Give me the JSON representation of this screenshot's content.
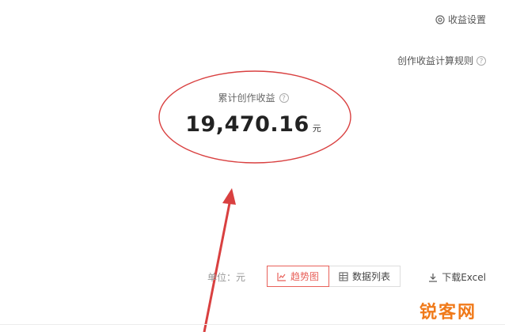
{
  "header": {
    "settings_label": "收益设置",
    "settings_icon": "gear-icon",
    "rules_label": "创作收益计算规则",
    "help_icon": "help-circle-icon",
    "help_glyph": "?"
  },
  "summary": {
    "label": "累计创作收益",
    "amount": "19,470.16",
    "unit": "元"
  },
  "toolbar": {
    "unit_label": "单位：元",
    "views": [
      {
        "label": "趋势图",
        "icon": "line-chart-icon",
        "active": true
      },
      {
        "label": "数据列表",
        "icon": "table-icon",
        "active": false
      }
    ],
    "download_label": "下载Excel",
    "download_icon": "download-icon"
  },
  "watermark": {
    "text": "锐客网"
  },
  "colors": {
    "accent": "#e8615a",
    "annotation": "#d94040",
    "watermark": "#f07a1a"
  }
}
